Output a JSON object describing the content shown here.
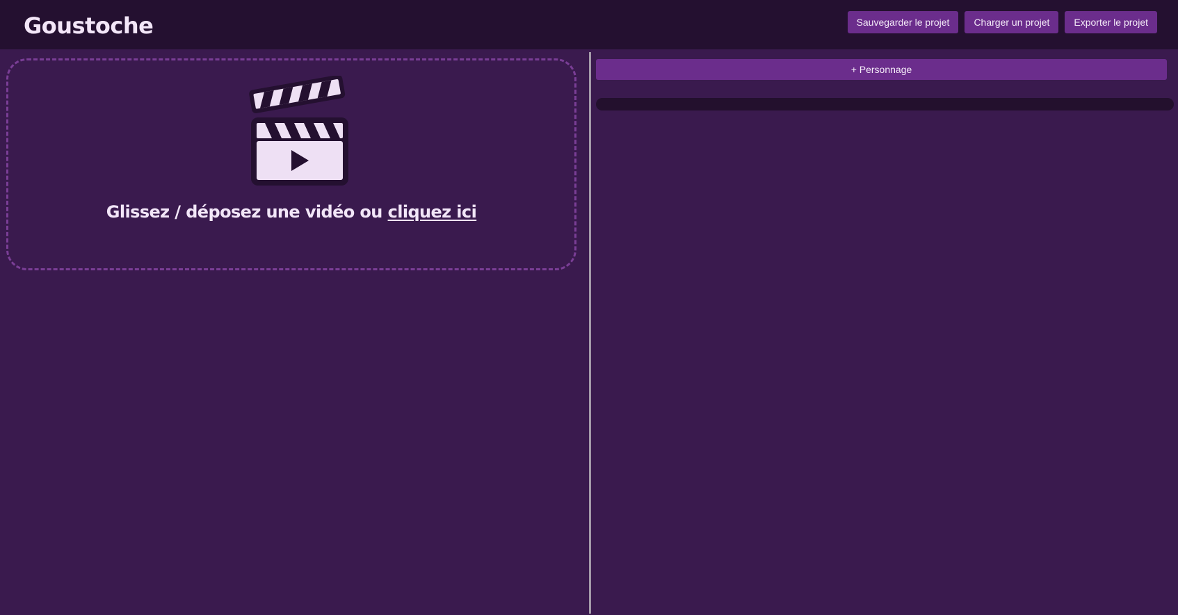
{
  "header": {
    "title": "Goustoche",
    "buttons": {
      "save_label": "Sauvegarder le projet",
      "load_label": "Charger un projet",
      "export_label": "Exporter le projet"
    }
  },
  "drop_zone": {
    "icon": "clapperboard-play-icon",
    "text": "Glissez / déposez une vidéo ou",
    "link_text": "cliquez ici"
  },
  "characters": {
    "add_label": "+ Personnage"
  },
  "colors": {
    "background": "#3a1a4e",
    "header_background": "#241030",
    "accent": "#6b2d8c",
    "dashed_border": "#7a3e96",
    "text": "#f2e6f8",
    "timeline_track": "#23102d"
  }
}
